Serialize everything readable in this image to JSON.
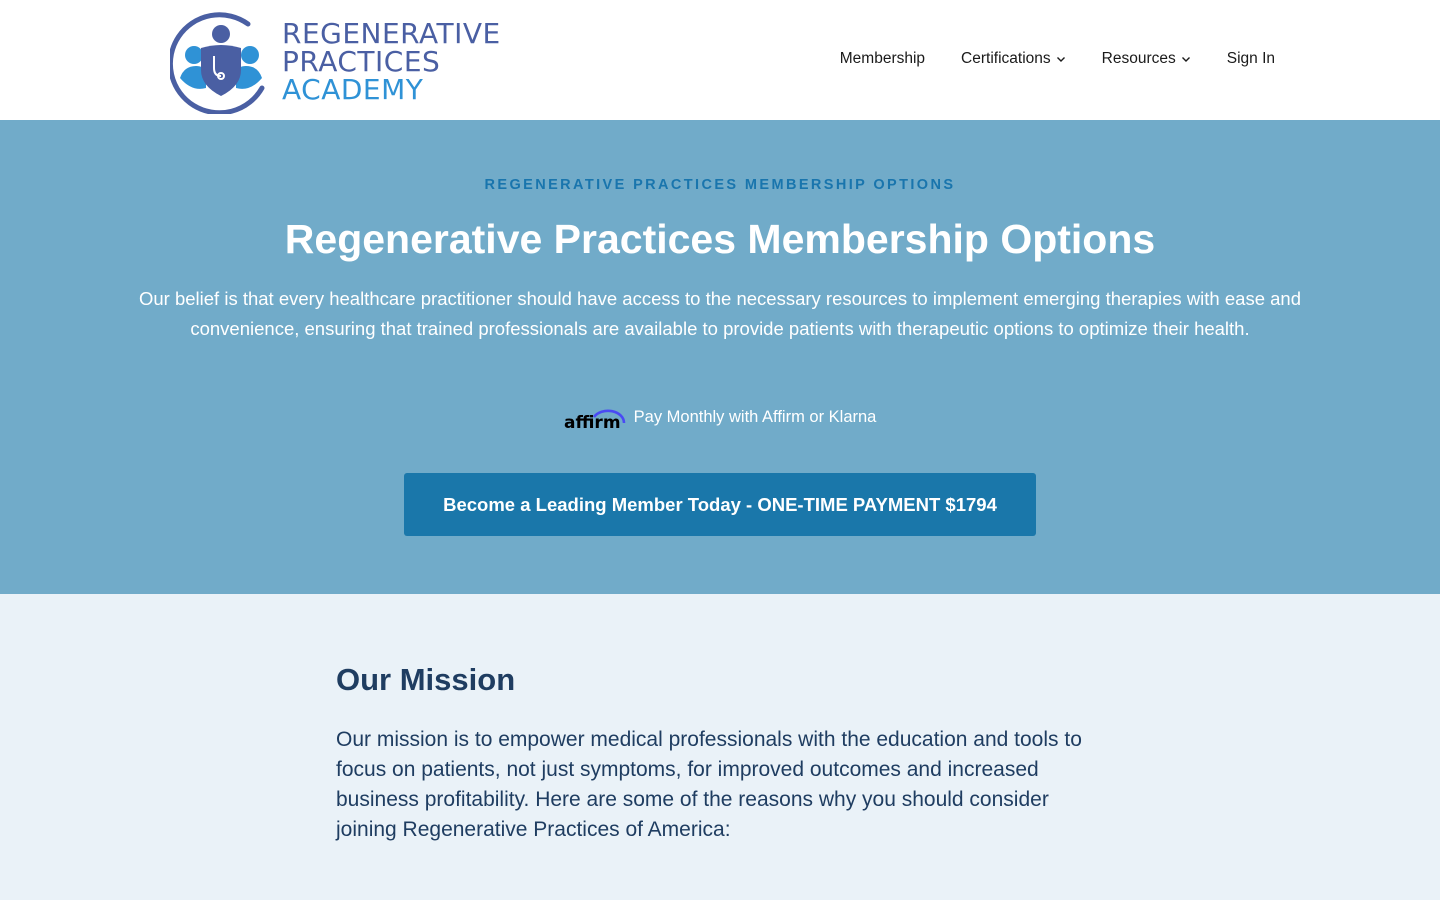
{
  "header": {
    "logo": {
      "line1": "REGENERATIVE",
      "line2": "PRACTICES",
      "line3": "ACADEMY",
      "icon": "medical-team-shield-icon"
    },
    "nav": [
      {
        "label": "Membership",
        "has_dropdown": false
      },
      {
        "label": "Certifications",
        "has_dropdown": true
      },
      {
        "label": "Resources",
        "has_dropdown": true
      },
      {
        "label": "Sign In",
        "has_dropdown": false
      }
    ]
  },
  "hero": {
    "eyebrow": "REGENERATIVE PRACTICES MEMBERSHIP OPTIONS",
    "title": "Regenerative Practices Membership Options",
    "description": "Our belief is that every healthcare practitioner should have access to the necessary resources to implement emerging therapies with ease and convenience, ensuring that trained professionals are available to provide patients with therapeutic options to optimize their health.",
    "affirm_logo_text": "affirm",
    "affirm_text": "Pay Monthly with Affirm or Klarna",
    "cta_label": "Become a Leading Member Today - ONE-TIME PAYMENT $1794"
  },
  "mission": {
    "title": "Our Mission",
    "text": "Our mission is to empower medical professionals with the education and tools to focus on patients, not just symptoms, for improved outcomes and increased business profitability. Here are some of the reasons why you should consider joining Regenerative Practices of America:"
  },
  "colors": {
    "hero_bg": "#71abc9",
    "cta_bg": "#1a77aa",
    "eyebrow": "#1975ad",
    "mission_bg": "#eaf2f8",
    "mission_text": "#1f3d61",
    "logo_primary": "#4a5fa3",
    "logo_accent": "#2f92d6"
  }
}
